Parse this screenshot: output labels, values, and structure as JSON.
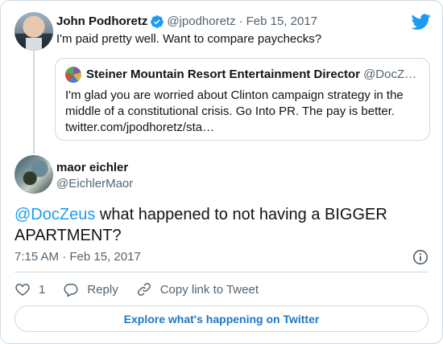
{
  "parent_tweet": {
    "name": "John Podhoretz",
    "handle": "@jpodhoretz",
    "separator": "·",
    "date": "Feb 15, 2017",
    "text": "I'm paid pretty well. Want to compare paychecks?",
    "verified_icon": "verified-badge-icon",
    "logo_icon": "twitter-bird-icon"
  },
  "quoted_tweet": {
    "name": "Steiner Mountain Resort Entertainment Director",
    "handle": "@DocZ…",
    "text_line1": "I'm glad you are worried about Clinton campaign strategy in the",
    "text_line2": "middle of a constitutional crisis. Go Into PR. The pay is better.",
    "text_line3": "twitter.com/jpodhoretz/sta…"
  },
  "main_tweet": {
    "name": "maor eichler",
    "handle": "@EichlerMaor",
    "mention": "@DocZeus",
    "text_line1_rest": " what happened to not having a BIGGER",
    "text_line2": "APARTMENT?",
    "time": "7:15 AM",
    "separator": "·",
    "date": "Feb 15, 2017"
  },
  "actions": {
    "like_count": "1",
    "reply_label": "Reply",
    "copy_link_label": "Copy link to Tweet"
  },
  "explore_label": "Explore what's happening on Twitter",
  "colors": {
    "accent": "#1d9bf0",
    "text": "#0f1419",
    "secondary": "#536471",
    "border": "#cfd9de"
  }
}
